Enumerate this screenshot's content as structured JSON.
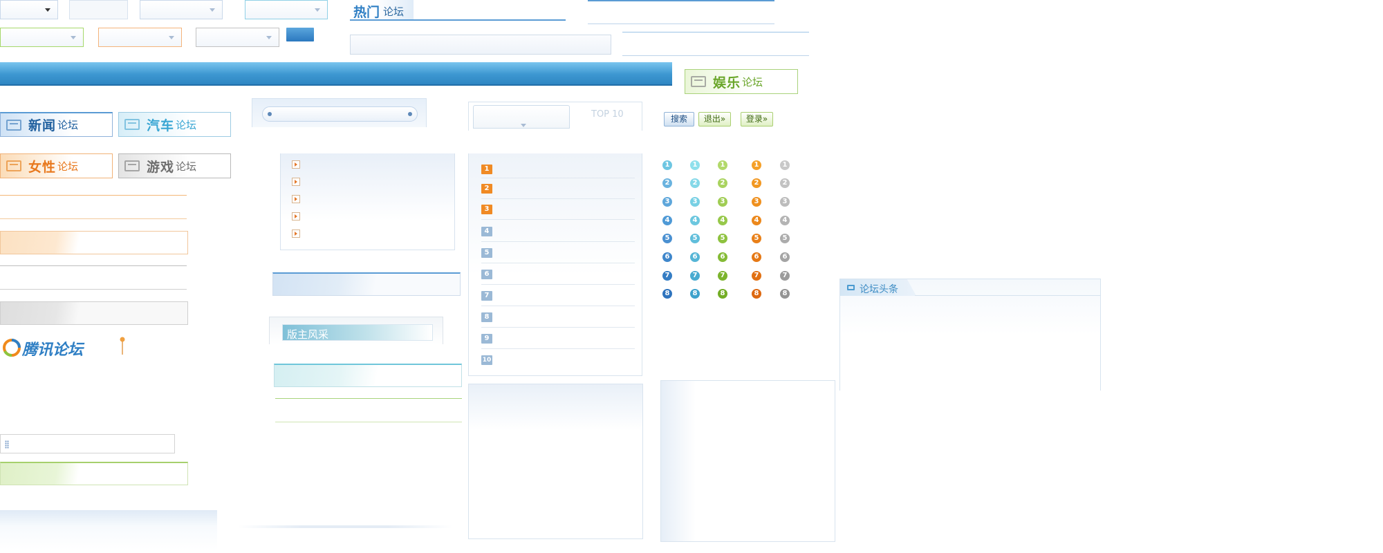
{
  "forum_titles": {
    "hot_main": "热门",
    "hot_sub": "论坛",
    "entertainment_main": "娱乐",
    "entertainment_sub": "论坛",
    "news_main": "新闻",
    "news_sub": "论坛",
    "car_main": "汽车",
    "car_sub": "论坛",
    "women_main": "女性",
    "women_sub": "论坛",
    "games_main": "游戏",
    "games_sub": "论坛"
  },
  "brand": {
    "logo_text": "腾讯论坛"
  },
  "top10": {
    "label": "TOP 10",
    "numbers": [
      "1",
      "2",
      "3",
      "4",
      "5",
      "6",
      "7",
      "8",
      "9",
      "10"
    ]
  },
  "buttons": {
    "search": "搜索",
    "logout": "退出»",
    "login": "登录»"
  },
  "moderator": {
    "label": "版主风采"
  },
  "headline": {
    "label": "论坛头条"
  },
  "badges": {
    "numbers": [
      "1",
      "2",
      "3",
      "4",
      "5",
      "6",
      "7",
      "8"
    ]
  },
  "colors": {
    "blue": "#2f7fc4",
    "cyan": "#5fc8df",
    "green": "#8cc63f",
    "orange": "#f08a1c",
    "gray": "#a8a8a8",
    "top3": "#f08a24",
    "rest": "#9bb9d6"
  }
}
